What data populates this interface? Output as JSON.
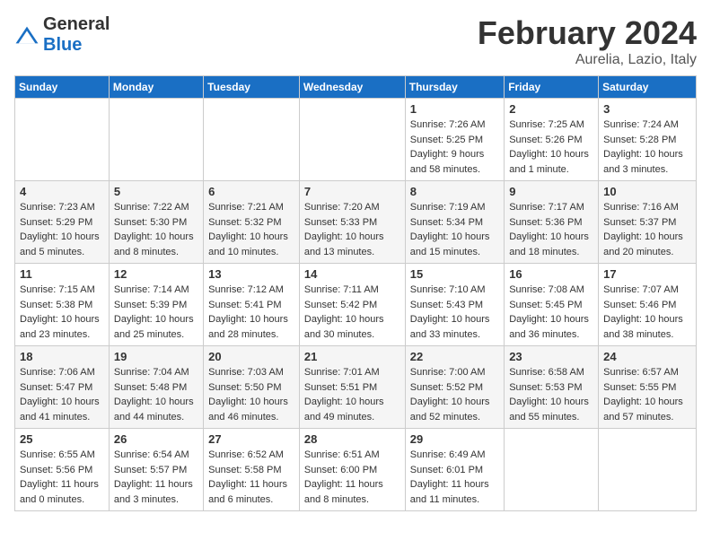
{
  "logo": {
    "general": "General",
    "blue": "Blue"
  },
  "title": "February 2024",
  "subtitle": "Aurelia, Lazio, Italy",
  "days_of_week": [
    "Sunday",
    "Monday",
    "Tuesday",
    "Wednesday",
    "Thursday",
    "Friday",
    "Saturday"
  ],
  "weeks": [
    [
      {
        "day": "",
        "info": ""
      },
      {
        "day": "",
        "info": ""
      },
      {
        "day": "",
        "info": ""
      },
      {
        "day": "",
        "info": ""
      },
      {
        "day": "1",
        "sunrise": "7:26 AM",
        "sunset": "5:25 PM",
        "daylight": "Daylight: 9 hours and 58 minutes."
      },
      {
        "day": "2",
        "sunrise": "7:25 AM",
        "sunset": "5:26 PM",
        "daylight": "Daylight: 10 hours and 1 minute."
      },
      {
        "day": "3",
        "sunrise": "7:24 AM",
        "sunset": "5:28 PM",
        "daylight": "Daylight: 10 hours and 3 minutes."
      }
    ],
    [
      {
        "day": "4",
        "sunrise": "7:23 AM",
        "sunset": "5:29 PM",
        "daylight": "Daylight: 10 hours and 5 minutes."
      },
      {
        "day": "5",
        "sunrise": "7:22 AM",
        "sunset": "5:30 PM",
        "daylight": "Daylight: 10 hours and 8 minutes."
      },
      {
        "day": "6",
        "sunrise": "7:21 AM",
        "sunset": "5:32 PM",
        "daylight": "Daylight: 10 hours and 10 minutes."
      },
      {
        "day": "7",
        "sunrise": "7:20 AM",
        "sunset": "5:33 PM",
        "daylight": "Daylight: 10 hours and 13 minutes."
      },
      {
        "day": "8",
        "sunrise": "7:19 AM",
        "sunset": "5:34 PM",
        "daylight": "Daylight: 10 hours and 15 minutes."
      },
      {
        "day": "9",
        "sunrise": "7:17 AM",
        "sunset": "5:36 PM",
        "daylight": "Daylight: 10 hours and 18 minutes."
      },
      {
        "day": "10",
        "sunrise": "7:16 AM",
        "sunset": "5:37 PM",
        "daylight": "Daylight: 10 hours and 20 minutes."
      }
    ],
    [
      {
        "day": "11",
        "sunrise": "7:15 AM",
        "sunset": "5:38 PM",
        "daylight": "Daylight: 10 hours and 23 minutes."
      },
      {
        "day": "12",
        "sunrise": "7:14 AM",
        "sunset": "5:39 PM",
        "daylight": "Daylight: 10 hours and 25 minutes."
      },
      {
        "day": "13",
        "sunrise": "7:12 AM",
        "sunset": "5:41 PM",
        "daylight": "Daylight: 10 hours and 28 minutes."
      },
      {
        "day": "14",
        "sunrise": "7:11 AM",
        "sunset": "5:42 PM",
        "daylight": "Daylight: 10 hours and 30 minutes."
      },
      {
        "day": "15",
        "sunrise": "7:10 AM",
        "sunset": "5:43 PM",
        "daylight": "Daylight: 10 hours and 33 minutes."
      },
      {
        "day": "16",
        "sunrise": "7:08 AM",
        "sunset": "5:45 PM",
        "daylight": "Daylight: 10 hours and 36 minutes."
      },
      {
        "day": "17",
        "sunrise": "7:07 AM",
        "sunset": "5:46 PM",
        "daylight": "Daylight: 10 hours and 38 minutes."
      }
    ],
    [
      {
        "day": "18",
        "sunrise": "7:06 AM",
        "sunset": "5:47 PM",
        "daylight": "Daylight: 10 hours and 41 minutes."
      },
      {
        "day": "19",
        "sunrise": "7:04 AM",
        "sunset": "5:48 PM",
        "daylight": "Daylight: 10 hours and 44 minutes."
      },
      {
        "day": "20",
        "sunrise": "7:03 AM",
        "sunset": "5:50 PM",
        "daylight": "Daylight: 10 hours and 46 minutes."
      },
      {
        "day": "21",
        "sunrise": "7:01 AM",
        "sunset": "5:51 PM",
        "daylight": "Daylight: 10 hours and 49 minutes."
      },
      {
        "day": "22",
        "sunrise": "7:00 AM",
        "sunset": "5:52 PM",
        "daylight": "Daylight: 10 hours and 52 minutes."
      },
      {
        "day": "23",
        "sunrise": "6:58 AM",
        "sunset": "5:53 PM",
        "daylight": "Daylight: 10 hours and 55 minutes."
      },
      {
        "day": "24",
        "sunrise": "6:57 AM",
        "sunset": "5:55 PM",
        "daylight": "Daylight: 10 hours and 57 minutes."
      }
    ],
    [
      {
        "day": "25",
        "sunrise": "6:55 AM",
        "sunset": "5:56 PM",
        "daylight": "Daylight: 11 hours and 0 minutes."
      },
      {
        "day": "26",
        "sunrise": "6:54 AM",
        "sunset": "5:57 PM",
        "daylight": "Daylight: 11 hours and 3 minutes."
      },
      {
        "day": "27",
        "sunrise": "6:52 AM",
        "sunset": "5:58 PM",
        "daylight": "Daylight: 11 hours and 6 minutes."
      },
      {
        "day": "28",
        "sunrise": "6:51 AM",
        "sunset": "6:00 PM",
        "daylight": "Daylight: 11 hours and 8 minutes."
      },
      {
        "day": "29",
        "sunrise": "6:49 AM",
        "sunset": "6:01 PM",
        "daylight": "Daylight: 11 hours and 11 minutes."
      },
      {
        "day": "",
        "info": ""
      },
      {
        "day": "",
        "info": ""
      }
    ]
  ]
}
